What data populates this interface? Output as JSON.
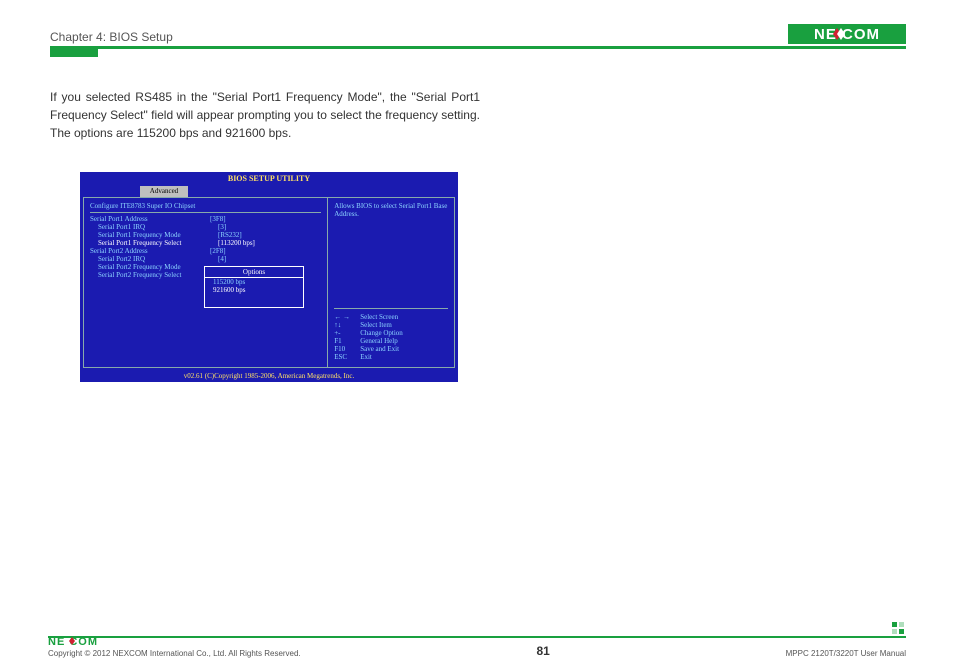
{
  "header": {
    "chapter": "Chapter 4: BIOS Setup",
    "brand": "NEXCOM"
  },
  "body_text": "If you selected RS485 in the \"Serial Port1 Frequency Mode\", the \"Serial Port1 Frequency Select\" field will appear prompting you to select the frequency setting. The options are 115200 bps and 921600 bps.",
  "bios": {
    "title": "BIOS SETUP UTILITY",
    "tab": "Advanced",
    "heading": "Configure ITE8783 Super IO Chipset",
    "rows": [
      {
        "label": "Serial Port1 Address",
        "value": "[3F8]",
        "indent": false,
        "hl": false
      },
      {
        "label": "Serial Port1 IRQ",
        "value": "[3]",
        "indent": true,
        "hl": false
      },
      {
        "label": "Serial Port1 Frequency Mode",
        "value": "[RS232]",
        "indent": true,
        "hl": false
      },
      {
        "label": "Serial Port1 Frequency Select",
        "value": "[113200 bps]",
        "indent": true,
        "hl": true
      },
      {
        "label": "Serial Port2 Address",
        "value": "[2F8]",
        "indent": false,
        "hl": false
      },
      {
        "label": "Serial Port2 IRQ",
        "value": "[4]",
        "indent": true,
        "hl": false
      },
      {
        "label": "Serial Port2 Frequency Mode",
        "value": "",
        "indent": true,
        "hl": false
      },
      {
        "label": "Serial Port2 Frequency Select",
        "value": "",
        "indent": true,
        "hl": false
      }
    ],
    "popup_title": "Options",
    "popup_options": [
      "115200 bps",
      "921600 bps"
    ],
    "help": "Allows BIOS to select Serial Port1 Base Address.",
    "nav": [
      {
        "key": "← →",
        "desc": "Select Screen"
      },
      {
        "key": "↑↓",
        "desc": "Select Item"
      },
      {
        "key": "+-",
        "desc": "Change Option"
      },
      {
        "key": "F1",
        "desc": "General Help"
      },
      {
        "key": "F10",
        "desc": "Save and Exit"
      },
      {
        "key": "ESC",
        "desc": "Exit"
      }
    ],
    "footer": "v02.61 (C)Copyright 1985-2006, American Megatrends, Inc."
  },
  "footer": {
    "copyright": "Copyright © 2012 NEXCOM International Co., Ltd. All Rights Reserved.",
    "page": "81",
    "manual": "MPPC 2120T/3220T User Manual"
  }
}
